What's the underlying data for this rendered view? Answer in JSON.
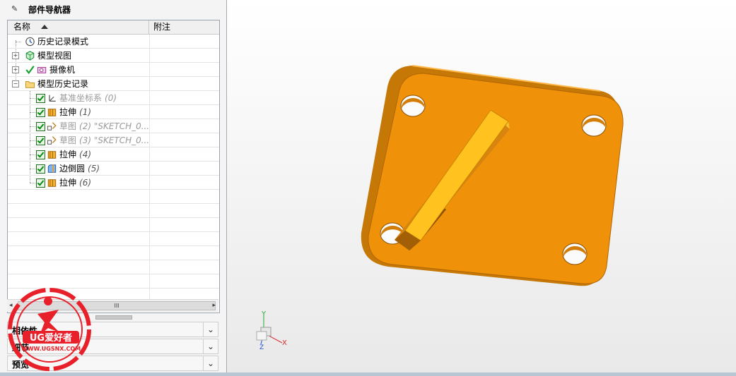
{
  "navigator": {
    "title": "部件导航器",
    "columns": {
      "name": "名称",
      "note": "附注"
    },
    "items": [
      {
        "label": "历史记录模式",
        "sub": "",
        "icon": "clock-icon"
      },
      {
        "label": "模型视图",
        "sub": "",
        "icon": "model-views-icon"
      },
      {
        "label": "摄像机",
        "sub": "",
        "icon": "camera-icon"
      },
      {
        "label": "模型历史记录",
        "sub": "",
        "icon": "folder-icon"
      },
      {
        "label": "基准坐标系",
        "sub": "(0)",
        "icon": "datum-csys-icon"
      },
      {
        "label": "拉伸",
        "sub": "(1)",
        "icon": "extrude-icon"
      },
      {
        "label": "草图",
        "sub": "(2) \"SKETCH_0...",
        "icon": "sketch-icon"
      },
      {
        "label": "草图",
        "sub": "(3) \"SKETCH_0...",
        "icon": "sketch-icon"
      },
      {
        "label": "拉伸",
        "sub": "(4)",
        "icon": "extrude-icon"
      },
      {
        "label": "边倒圆",
        "sub": "(5)",
        "icon": "edge-blend-icon"
      },
      {
        "label": "拉伸",
        "sub": "(6)",
        "icon": "extrude-icon"
      }
    ],
    "scrollbar_thumb": "III",
    "panels": {
      "dependencies": "相依性",
      "details": "细节",
      "preview": "预览"
    }
  },
  "triad": {
    "x": "X",
    "y": "Y",
    "z": "Z"
  },
  "watermark": {
    "brand": "UG爱好者",
    "url": "WWW.UGSNX.COM"
  },
  "colors": {
    "part": "#f0960a",
    "part_dark": "#a35f05",
    "selection": "#3a8ad8"
  }
}
